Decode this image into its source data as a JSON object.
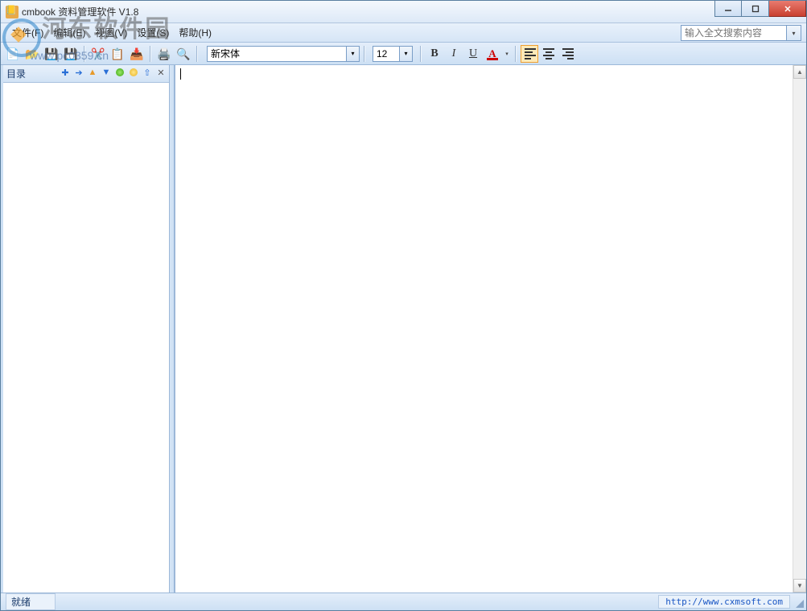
{
  "window": {
    "title": "cmbook 资料管理软件 V1.8"
  },
  "watermark": {
    "big": "河东软件园",
    "small": "www.pc0359.cn"
  },
  "menubar": {
    "items": [
      {
        "label": "文件(F)"
      },
      {
        "label": "编辑(E)"
      },
      {
        "label": "视图(V)"
      },
      {
        "label": "设置(S)"
      },
      {
        "label": "帮助(H)"
      }
    ]
  },
  "search": {
    "placeholder": "输入全文搜索内容"
  },
  "toolbar": {
    "buttons": [
      "new",
      "open",
      "save",
      "save-all",
      "cut",
      "copy",
      "paste",
      "print",
      "print-preview"
    ],
    "font_family": "新宋体",
    "font_size": "12",
    "bold": "B",
    "italic": "I",
    "underline": "U",
    "color_label": "A"
  },
  "sidebar": {
    "title": "目录",
    "tool_icons": [
      "add",
      "next",
      "up",
      "down",
      "green",
      "yellow",
      "pin",
      "close"
    ]
  },
  "status": {
    "ready": "就绪",
    "url": "http://www.cxmsoft.com"
  }
}
